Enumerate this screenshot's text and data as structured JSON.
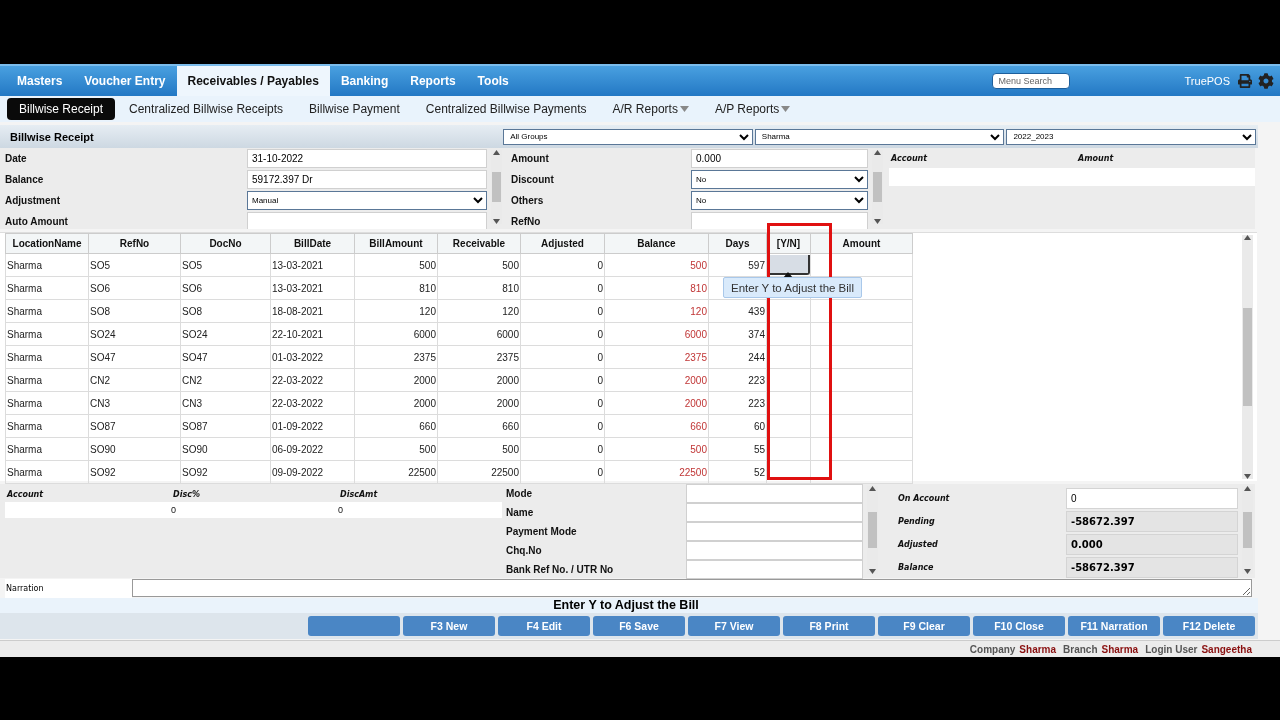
{
  "top_menu": {
    "items": [
      {
        "label": "Masters",
        "selected": false
      },
      {
        "label": "Voucher Entry",
        "selected": false
      },
      {
        "label": "Receivables / Payables",
        "selected": true
      },
      {
        "label": "Banking",
        "selected": false
      },
      {
        "label": "Reports",
        "selected": false
      },
      {
        "label": "Tools",
        "selected": false
      }
    ],
    "search": {
      "placeholder": "Menu Search"
    },
    "brand": "TruePOS"
  },
  "sub_menu": [
    {
      "label": "Billwise Receipt",
      "selected": true,
      "dropdown": false
    },
    {
      "label": "Centralized Billwise Receipts",
      "selected": false,
      "dropdown": false
    },
    {
      "label": "Billwise Payment",
      "selected": false,
      "dropdown": false
    },
    {
      "label": "Centralized Billwise Payments",
      "selected": false,
      "dropdown": false
    },
    {
      "label": "A/R Reports",
      "selected": false,
      "dropdown": true
    },
    {
      "label": "A/P Reports",
      "selected": false,
      "dropdown": true
    }
  ],
  "title_bar": {
    "title": "Billwise Receipt",
    "filters": [
      "All Groups",
      "Sharma",
      "2022_2023"
    ]
  },
  "form": {
    "left_fields": [
      {
        "label": "Date",
        "kind": "text",
        "value": "31-10-2022"
      },
      {
        "label": "Balance",
        "kind": "text",
        "value": "59172.397 Dr"
      },
      {
        "label": "Adjustment",
        "kind": "select",
        "value": "Manual"
      },
      {
        "label": "Auto Amount",
        "kind": "text"
      }
    ],
    "middle_fields": [
      {
        "label": "Amount",
        "kind": "text",
        "value": "0.000"
      },
      {
        "label": "Discount",
        "kind": "select",
        "value": "No"
      },
      {
        "label": "Others",
        "kind": "select",
        "value": "No"
      },
      {
        "label": "RefNo",
        "kind": "text"
      }
    ],
    "account_table": {
      "columns": [
        "Account",
        "Amount"
      ]
    }
  },
  "bills": {
    "columns": [
      "LocationName",
      "RefNo",
      "DocNo",
      "BillDate",
      "BillAmount",
      "Receivable",
      "Adjusted",
      "Balance",
      "Days",
      "[Y/N]",
      "Amount"
    ],
    "rows": [
      {
        "location": "Sharma",
        "ref_no": "SO5",
        "doc_no": "SO5",
        "bill_date": "13-03-2021",
        "bill_amount": "500",
        "receivable": "500",
        "adjusted": "0",
        "balance": "500",
        "days": "597",
        "selected": true
      },
      {
        "location": "Sharma",
        "ref_no": "SO6",
        "doc_no": "SO6",
        "bill_date": "13-03-2021",
        "bill_amount": "810",
        "receivable": "810",
        "adjusted": "0",
        "balance": "810",
        "selected": false
      },
      {
        "location": "Sharma",
        "ref_no": "SO8",
        "doc_no": "SO8",
        "bill_date": "18-08-2021",
        "bill_amount": "120",
        "receivable": "120",
        "adjusted": "0",
        "balance": "120",
        "days": "439",
        "selected": false
      },
      {
        "location": "Sharma",
        "ref_no": "SO24",
        "doc_no": "SO24",
        "bill_date": "22-10-2021",
        "bill_amount": "6000",
        "receivable": "6000",
        "adjusted": "0",
        "balance": "6000",
        "days": "374",
        "selected": false
      },
      {
        "location": "Sharma",
        "ref_no": "SO47",
        "doc_no": "SO47",
        "bill_date": "01-03-2022",
        "bill_amount": "2375",
        "receivable": "2375",
        "adjusted": "0",
        "balance": "2375",
        "days": "244",
        "selected": false
      },
      {
        "location": "Sharma",
        "ref_no": "CN2",
        "doc_no": "CN2",
        "bill_date": "22-03-2022",
        "bill_amount": "2000",
        "receivable": "2000",
        "adjusted": "0",
        "balance": "2000",
        "days": "223",
        "selected": false
      },
      {
        "location": "Sharma",
        "ref_no": "CN3",
        "doc_no": "CN3",
        "bill_date": "22-03-2022",
        "bill_amount": "2000",
        "receivable": "2000",
        "adjusted": "0",
        "balance": "2000",
        "days": "223",
        "selected": false
      },
      {
        "location": "Sharma",
        "ref_no": "SO87",
        "doc_no": "SO87",
        "bill_date": "01-09-2022",
        "bill_amount": "660",
        "receivable": "660",
        "adjusted": "0",
        "balance": "660",
        "days": "60",
        "selected": false
      },
      {
        "location": "Sharma",
        "ref_no": "SO90",
        "doc_no": "SO90",
        "bill_date": "06-09-2022",
        "bill_amount": "500",
        "receivable": "500",
        "adjusted": "0",
        "balance": "500",
        "days": "55",
        "selected": false
      },
      {
        "location": "Sharma",
        "ref_no": "SO92",
        "doc_no": "SO92",
        "bill_date": "09-09-2022",
        "bill_amount": "22500",
        "receivable": "22500",
        "adjusted": "0",
        "balance": "22500",
        "days": "52",
        "selected": false
      }
    ]
  },
  "tooltip": "Enter Y to Adjust the Bill",
  "discount": {
    "columns": [
      "Account",
      "Disc%",
      "DiscAmt"
    ],
    "disc_pct": "0",
    "disc_amt": "0"
  },
  "payment": {
    "fields": [
      "Mode",
      "Name",
      "Payment Mode",
      "Chq.No",
      "Bank Ref No. / UTR No"
    ]
  },
  "summary": [
    {
      "label": "On Account",
      "value": "0",
      "editable": true
    },
    {
      "label": "Pending",
      "value": "-58672.397",
      "editable": false
    },
    {
      "label": "Adjusted",
      "value": "0.000",
      "editable": false
    },
    {
      "label": "Balance",
      "value": "-58672.397",
      "editable": false
    }
  ],
  "narration": {
    "label": "Narration"
  },
  "message": "Enter Y to Adjust the Bill",
  "buttons": [
    {
      "kind": "blank"
    },
    {
      "kind": "action",
      "label": "F3 New"
    },
    {
      "kind": "action",
      "label": "F4 Edit"
    },
    {
      "kind": "action",
      "label": "F6 Save"
    },
    {
      "kind": "action",
      "label": "F7 View"
    },
    {
      "kind": "action",
      "label": "F8 Print"
    },
    {
      "kind": "action",
      "label": "F9 Clear"
    },
    {
      "kind": "action",
      "label": "F10 Close"
    },
    {
      "kind": "action",
      "label": "F11 Narration"
    },
    {
      "kind": "action",
      "label": "F12 Delete"
    }
  ],
  "footer": [
    {
      "label": "Company",
      "value": "Sharma"
    },
    {
      "label": "Branch",
      "value": "Sharma"
    },
    {
      "label": "Login User",
      "value": "Sangeetha"
    }
  ]
}
